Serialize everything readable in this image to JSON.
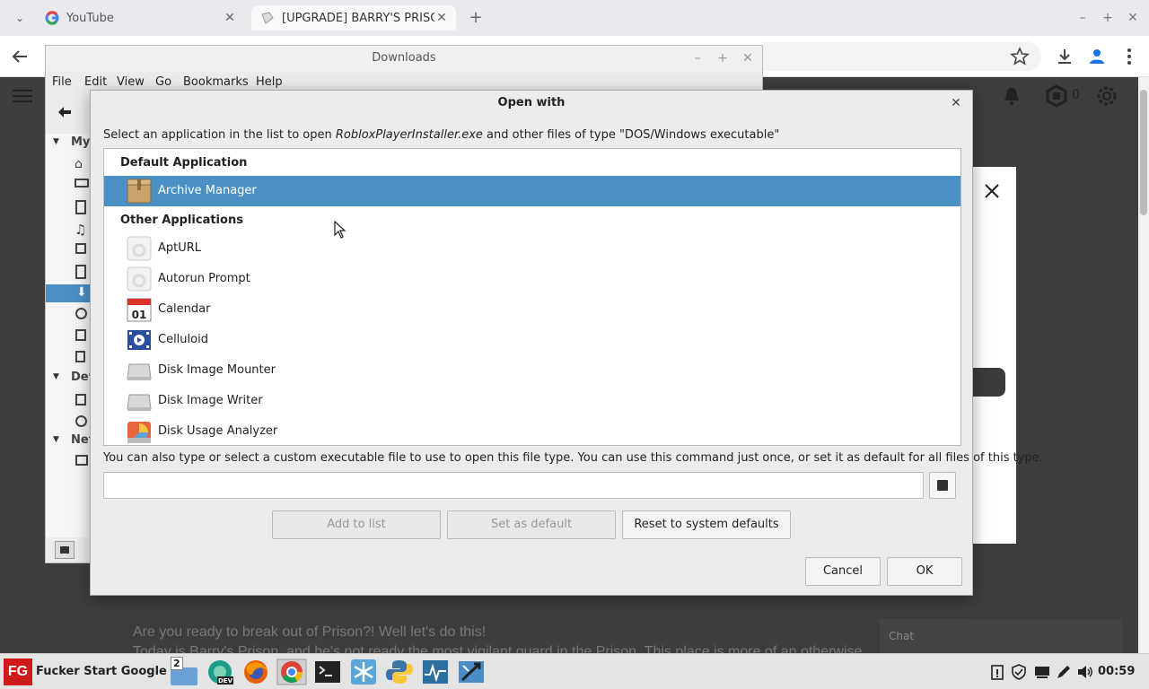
{
  "browser": {
    "tabs": [
      {
        "title": "YouTube",
        "close": "✕"
      },
      {
        "title": "[UPGRADE] BARRY'S PRISO",
        "close": "✕"
      }
    ],
    "new_tab": "+",
    "window_controls": [
      "–",
      "+",
      "✕"
    ]
  },
  "page": {
    "line1": "Are you ready to break out of Prison?! Well let's do this!",
    "line2": "Today is Barry's Prison, and he's not ready the most vigilant guard in the Prison. This place is more of an otherwise",
    "chat": "Chat"
  },
  "file_manager": {
    "title": "Downloads",
    "window_controls": [
      "–",
      "+",
      "✕"
    ],
    "menu": [
      "File",
      "Edit",
      "View",
      "Go",
      "Bookmarks",
      "Help"
    ],
    "sidebar_sections": [
      "My",
      "Dev",
      "Net"
    ]
  },
  "dialog": {
    "title": "Open with",
    "close": "✕",
    "instruction_prefix": "Select an application in the list to open ",
    "filename": "RobloxPlayerInstaller.exe",
    "instruction_suffix": " and other files of type \"DOS/Windows executable\"",
    "default_header": "Default Application",
    "default_app": "Archive Manager",
    "other_header": "Other Applications",
    "other_apps": [
      "AptURL",
      "Autorun Prompt",
      "Calendar",
      "Celluloid",
      "Disk Image Mounter",
      "Disk Image Writer",
      "Disk Usage Analyzer"
    ],
    "calendar_day": "01",
    "custom_instruction": "You can also type or select a custom executable file to use to open this file type.  You can use this command just once, or set it as default for all files of this type.",
    "command_value": "",
    "buttons": {
      "add": "Add to list",
      "set_default": "Set as default",
      "reset": "Reset to system defaults",
      "cancel": "Cancel",
      "ok": "OK"
    }
  },
  "taskbar": {
    "start_logo": "FG",
    "start_label": "Fucker Start Google",
    "workspace_count": "2",
    "clock": "00:59"
  },
  "colors": {
    "selection": "#4a90c4",
    "start_red": "#d01919"
  }
}
